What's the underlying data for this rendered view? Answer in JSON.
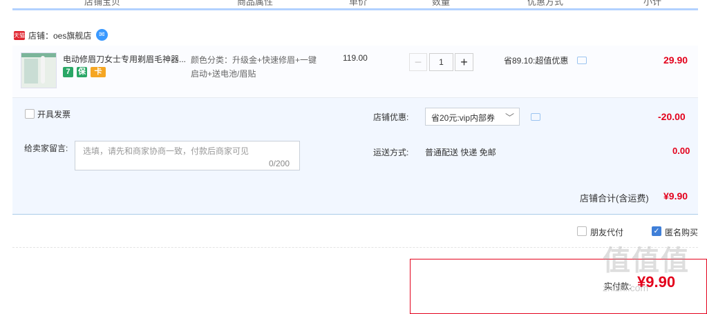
{
  "header": {
    "cols": [
      "店铺宝贝",
      "商品属性",
      "单价",
      "数量",
      "优惠方式",
      "小计"
    ]
  },
  "shop": {
    "tag": "天猫",
    "label": "店铺：oes旗舰店"
  },
  "item": {
    "title": "电动修眉刀女士专用剃眉毛神器...",
    "property": "颜色分类：升级金+快速修眉+一键启动+送电池/眉贴",
    "unit_price": "119.00",
    "quantity": "1",
    "discount": "省89.10:超值优惠",
    "subtotal": "29.90",
    "badges": [
      "7",
      "保",
      "卡"
    ]
  },
  "options": {
    "invoice_label": "开具发票",
    "message_label": "给卖家留言:",
    "message_placeholder": "选填，请先和商家协商一致，付款后商家可见",
    "message_count": "0/200",
    "coupon_label": "店铺优惠:",
    "coupon_value": "省20元:vip内部券",
    "coupon_amount": "-20.00",
    "shipping_label": "运送方式:",
    "shipping_value": "普通配送 快递 免邮",
    "shipping_amount": "0.00",
    "shop_total_label": "店铺合计(含运费)",
    "shop_total_value": "¥9.90"
  },
  "extras": {
    "friend_pay_label": "朋友代付",
    "anonymous_label": "匿名购买",
    "anonymous_checked": true
  },
  "payment": {
    "label": "实付款:",
    "value": "¥9.90"
  },
  "watermark": {
    "text": "值值值",
    "site": "zhizhi.com"
  },
  "colors": {
    "accent_red": "#e3001b",
    "header_rule": "#b2d1ff",
    "panel_bg": "#f2f7ff"
  }
}
